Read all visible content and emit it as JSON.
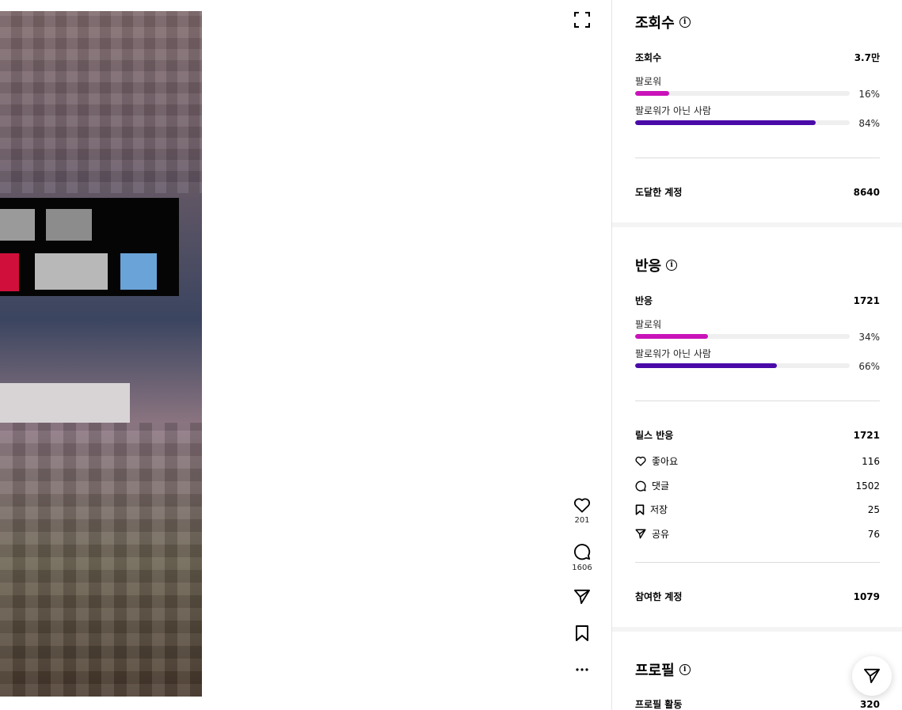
{
  "video": {
    "expand_icon": "expand-icon"
  },
  "actions": {
    "like_count": "201",
    "comment_count": "1606"
  },
  "views": {
    "title": "조회수",
    "total_label": "조회수",
    "total_value": "3.7만",
    "followers_label": "팔로워",
    "followers_pct": "16%",
    "followers_fraction": 0.16,
    "nonfollowers_label": "팔로워가 아닌 사람",
    "nonfollowers_pct": "84%",
    "nonfollowers_fraction": 0.84,
    "reached_label": "도달한 계정",
    "reached_value": "8640"
  },
  "reactions": {
    "title": "반응",
    "total_label": "반응",
    "total_value": "1721",
    "followers_label": "팔로워",
    "followers_pct": "34%",
    "followers_fraction": 0.34,
    "nonfollowers_label": "팔로워가 아닌 사람",
    "nonfollowers_pct": "66%",
    "nonfollowers_fraction": 0.66,
    "reels_label": "릴스 반응",
    "reels_value": "1721",
    "likes_label": "좋아요",
    "likes_value": "116",
    "comments_label": "댓글",
    "comments_value": "1502",
    "saves_label": "저장",
    "saves_value": "25",
    "shares_label": "공유",
    "shares_value": "76",
    "engaged_label": "참여한 계정",
    "engaged_value": "1079"
  },
  "profile": {
    "title": "프로필",
    "activity_label": "프로필 활동",
    "activity_value": "320"
  },
  "colors": {
    "followers": "#c913b9",
    "nonfollowers": "#4a0aa8"
  }
}
